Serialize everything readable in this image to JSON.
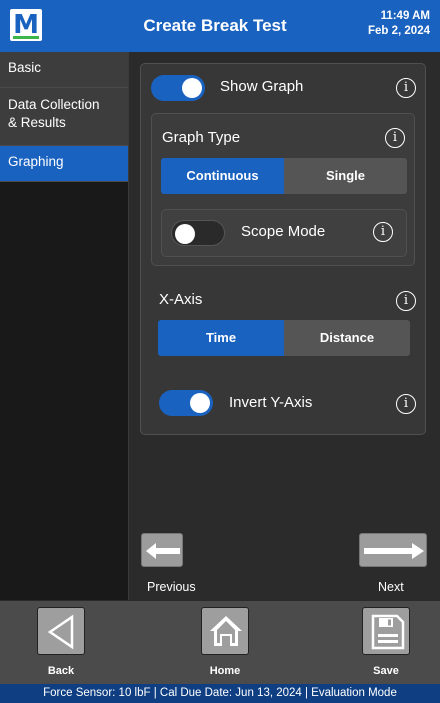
{
  "header": {
    "logo_letter": "M",
    "title": "Create Break Test",
    "time": "11:49 AM",
    "date": "Feb 2, 2024"
  },
  "sidebar": {
    "items": [
      {
        "label": "Basic"
      },
      {
        "label_line1": "Data Collection",
        "label_line2": "& Results"
      },
      {
        "label": "Graphing"
      }
    ]
  },
  "main": {
    "show_graph": {
      "label": "Show Graph",
      "enabled": true
    },
    "graph_type": {
      "label": "Graph Type",
      "options": [
        "Continuous",
        "Single"
      ],
      "selected": "Continuous"
    },
    "scope_mode": {
      "label": "Scope Mode",
      "enabled": false
    },
    "x_axis": {
      "label": "X-Axis",
      "options": [
        "Time",
        "Distance"
      ],
      "selected": "Time"
    },
    "invert_y": {
      "label": "Invert Y-Axis",
      "enabled": true
    },
    "info_glyph": "i"
  },
  "nav": {
    "previous_label": "Previous",
    "next_label": "Next"
  },
  "bottom": {
    "back_label": "Back",
    "home_label": "Home",
    "save_label": "Save"
  },
  "status_bar": {
    "text": "Force Sensor: 10 lbF  |  Cal Due Date: Jun 13, 2024  |  Evaluation Mode"
  },
  "colors": {
    "accent": "#1a62c0",
    "status_bar": "#0f3f82",
    "panel": "#373737",
    "logo_green": "#3cb54a"
  }
}
